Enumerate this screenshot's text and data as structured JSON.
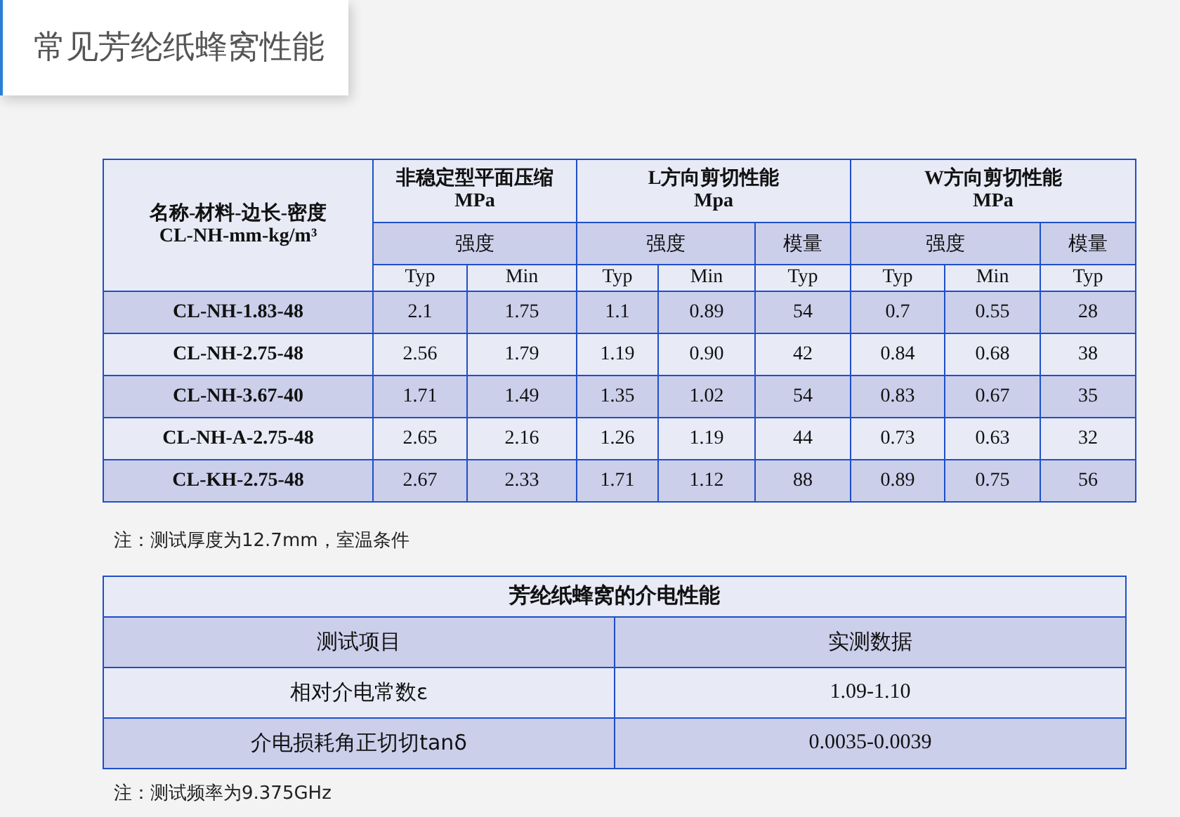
{
  "title": "常见芳纶纸蜂窝性能",
  "mechanical_table": {
    "name_header": [
      "名称-材料-边长-密度",
      "CL-NH-mm-kg/m³"
    ],
    "groups": [
      {
        "title": [
          "非稳定型平面压缩",
          "MPa"
        ],
        "subgroups": [
          {
            "label": "强度",
            "columns": [
              "Typ",
              "Min"
            ]
          }
        ]
      },
      {
        "title": [
          "L方向剪切性能",
          "Mpa"
        ],
        "subgroups": [
          {
            "label": "强度",
            "columns": [
              "Typ",
              "Min"
            ]
          },
          {
            "label": "模量",
            "columns": [
              "Typ"
            ]
          }
        ]
      },
      {
        "title": [
          "W方向剪切性能",
          "MPa"
        ],
        "subgroups": [
          {
            "label": "强度",
            "columns": [
              "Typ",
              "Min"
            ]
          },
          {
            "label": "模量",
            "columns": [
              "Typ"
            ]
          }
        ]
      }
    ],
    "rows": [
      {
        "name": "CL-NH-1.83-48",
        "values": [
          "2.1",
          "1.75",
          "1.1",
          "0.89",
          "54",
          "0.7",
          "0.55",
          "28"
        ]
      },
      {
        "name": "CL-NH-2.75-48",
        "values": [
          "2.56",
          "1.79",
          "1.19",
          "0.90",
          "42",
          "0.84",
          "0.68",
          "38"
        ]
      },
      {
        "name": "CL-NH-3.67-40",
        "values": [
          "1.71",
          "1.49",
          "1.35",
          "1.02",
          "54",
          "0.83",
          "0.67",
          "35"
        ]
      },
      {
        "name": "CL-NH-A-2.75-48",
        "values": [
          "2.65",
          "2.16",
          "1.26",
          "1.19",
          "44",
          "0.73",
          "0.63",
          "32"
        ]
      },
      {
        "name": "CL-KH-2.75-48",
        "values": [
          "2.67",
          "2.33",
          "1.71",
          "1.12",
          "88",
          "0.89",
          "0.75",
          "56"
        ]
      }
    ]
  },
  "note_1": "注：测试厚度为12.7mm，室温条件",
  "dielectric_table": {
    "title": "芳纶纸蜂窝的介电性能",
    "columns": [
      "测试项目",
      "实测数据"
    ],
    "rows": [
      [
        "相对介电常数ε",
        "1.09-1.10"
      ],
      [
        "介电损耗角正切切tanδ",
        "0.0035-0.0039"
      ]
    ]
  },
  "note_2": "注：测试频率为9.375GHz"
}
